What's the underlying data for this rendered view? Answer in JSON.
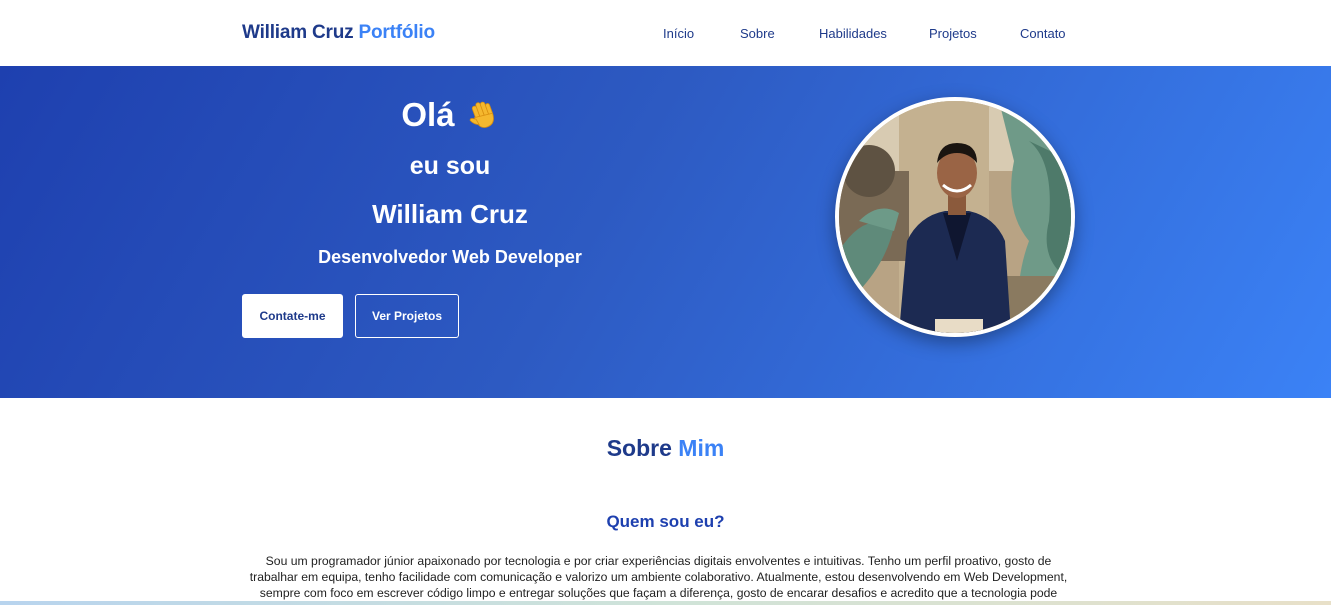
{
  "nav": {
    "brand_main": "William Cruz",
    "brand_accent": "Portfólio",
    "links": [
      "Início",
      "Sobre",
      "Habilidades",
      "Projetos",
      "Contato"
    ]
  },
  "hero": {
    "greeting": "Olá",
    "greeting_icon": "waving-hand-icon",
    "line2": "eu sou",
    "name": "William Cruz",
    "role": "Desenvolvedor Web Developer",
    "primary_button": "Contate-me",
    "secondary_button": "Ver Projetos",
    "profile_photo": "profile-photo"
  },
  "about": {
    "title_main": "Sobre",
    "title_accent": "Mim",
    "subtitle": "Quem sou eu?",
    "paragraph": "Sou um programador júnior apaixonado por tecnologia e por criar experiências digitais envolventes e intuitivas. Tenho um perfil proativo, gosto de trabalhar em equipa, tenho facilidade com comunicação e valorizo um ambiente colaborativo. Atualmente, estou desenvolvendo em Web Development, sempre com foco em escrever código limpo e entregar soluções que façam a diferença, gosto de encarar desafios e acredito que a tecnologia pode transformar a forma"
  },
  "colors": {
    "primary_dark": "#1e3a8a",
    "accent": "#3b82f6",
    "hero_gradient_start": "#1e40af",
    "hero_gradient_end": "#3b82f6"
  }
}
